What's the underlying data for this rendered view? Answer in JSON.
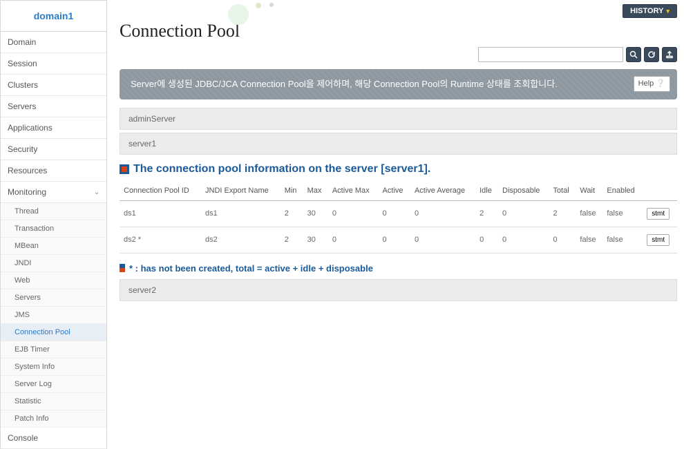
{
  "sidebar": {
    "domain_name": "domain1",
    "items": [
      {
        "label": "Domain"
      },
      {
        "label": "Session"
      },
      {
        "label": "Clusters"
      },
      {
        "label": "Servers"
      },
      {
        "label": "Applications"
      },
      {
        "label": "Security"
      },
      {
        "label": "Resources"
      },
      {
        "label": "Monitoring"
      }
    ],
    "monitoring_sub": [
      {
        "label": "Thread"
      },
      {
        "label": "Transaction"
      },
      {
        "label": "MBean"
      },
      {
        "label": "JNDI"
      },
      {
        "label": "Web"
      },
      {
        "label": "Servers"
      },
      {
        "label": "JMS"
      },
      {
        "label": "Connection Pool"
      },
      {
        "label": "EJB Timer"
      },
      {
        "label": "System Info"
      },
      {
        "label": "Server Log"
      },
      {
        "label": "Statistic"
      },
      {
        "label": "Patch Info"
      }
    ],
    "console_label": "Console"
  },
  "header": {
    "history_label": "HISTORY",
    "page_title": "Connection Pool",
    "search_placeholder": ""
  },
  "banner": {
    "text": "Server에 생성된 JDBC/JCA Connection Pool을 제어하며, 해당 Connection Pool의 Runtime 상태를 조회합니다.",
    "help_label": "Help"
  },
  "servers": {
    "admin": "adminServer",
    "s1": "server1",
    "s2": "server2"
  },
  "section": {
    "title": "The connection pool information on the server [server1]."
  },
  "table": {
    "headers": {
      "id": "Connection Pool ID",
      "jndi": "JNDI Export Name",
      "min": "Min",
      "max": "Max",
      "active_max": "Active Max",
      "active": "Active",
      "active_avg": "Active Average",
      "idle": "Idle",
      "disposable": "Disposable",
      "total": "Total",
      "wait": "Wait",
      "enabled": "Enabled"
    },
    "rows": [
      {
        "id": "ds1",
        "jndi": "ds1",
        "min": "2",
        "max": "30",
        "active_max": "0",
        "active": "0",
        "active_avg": "0",
        "idle": "2",
        "disposable": "0",
        "total": "2",
        "wait": "false",
        "enabled": "false"
      },
      {
        "id": "ds2 *",
        "jndi": "ds2",
        "min": "2",
        "max": "30",
        "active_max": "0",
        "active": "0",
        "active_avg": "0",
        "idle": "0",
        "disposable": "0",
        "total": "0",
        "wait": "false",
        "enabled": "false"
      }
    ],
    "stmt_label": "stmt"
  },
  "legend": {
    "text": "* : has not been created, total = active + idle + disposable"
  }
}
